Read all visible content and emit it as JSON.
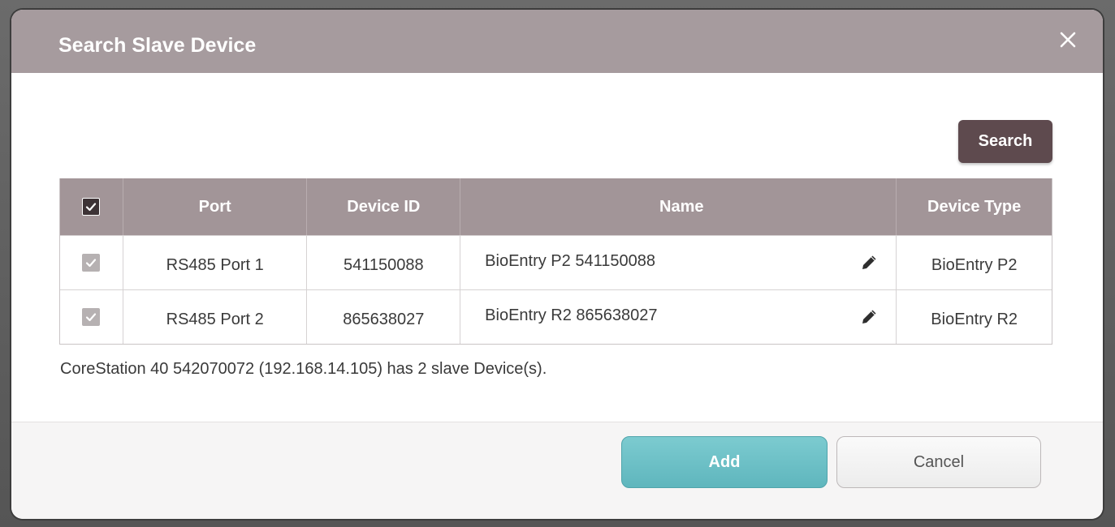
{
  "dialog": {
    "title": "Search Slave Device",
    "close_icon": "close-icon"
  },
  "toolbar": {
    "search_label": "Search"
  },
  "table": {
    "columns": {
      "check": {
        "checked": true
      },
      "port": "Port",
      "device_id": "Device ID",
      "name": "Name",
      "device_type": "Device Type"
    },
    "rows": [
      {
        "checked": true,
        "port": "RS485 Port 1",
        "device_id": "541150088",
        "name": "BioEntry P2 541150088",
        "device_type": "BioEntry P2"
      },
      {
        "checked": true,
        "port": "RS485 Port 2",
        "device_id": "865638027",
        "name": "BioEntry R2 865638027",
        "device_type": "BioEntry R2"
      }
    ]
  },
  "summary_text": "CoreStation 40 542070072 (192.168.14.105) has 2 slave Device(s).",
  "footer": {
    "add_label": "Add",
    "cancel_label": "Cancel"
  },
  "colors": {
    "header_bg": "#a69b9e",
    "table_header_bg": "#a29598",
    "search_button": "#5e4a4e",
    "add_button": "#6fc1c6"
  }
}
